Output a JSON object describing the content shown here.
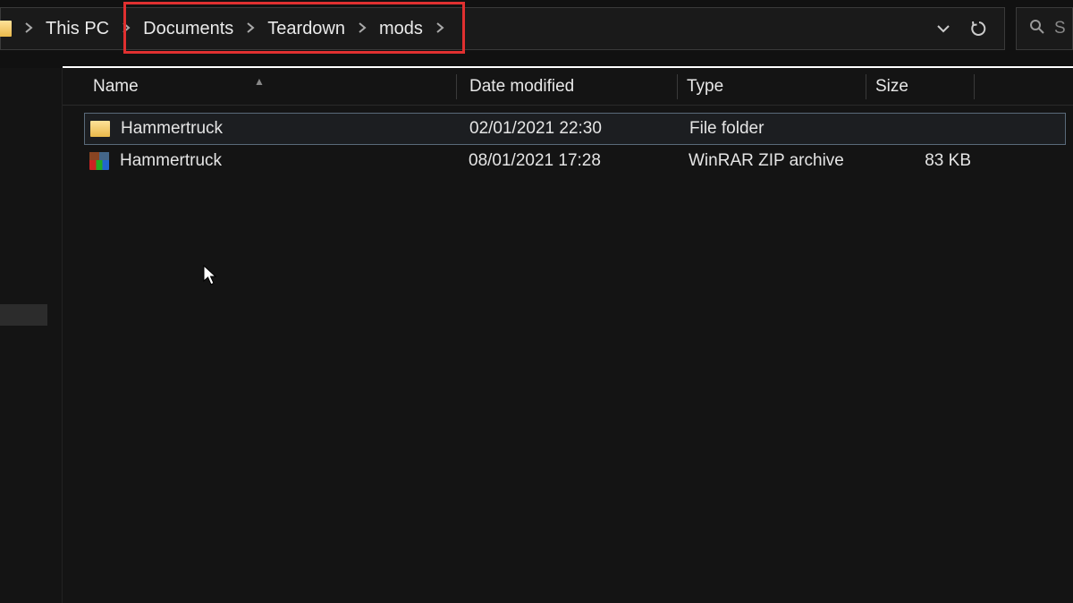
{
  "breadcrumb": {
    "root_label": "This PC",
    "items": [
      {
        "label": "Documents"
      },
      {
        "label": "Teardown"
      },
      {
        "label": "mods"
      }
    ]
  },
  "search": {
    "placeholder": "S"
  },
  "columns": {
    "name": "Name",
    "date": "Date modified",
    "type": "Type",
    "size": "Size"
  },
  "files": [
    {
      "icon": "folder",
      "name": "Hammertruck",
      "date": "02/01/2021 22:30",
      "type": "File folder",
      "size": "",
      "selected": true
    },
    {
      "icon": "zip",
      "name": "Hammertruck",
      "date": "08/01/2021 17:28",
      "type": "WinRAR ZIP archive",
      "size": "83 KB",
      "selected": false
    }
  ]
}
